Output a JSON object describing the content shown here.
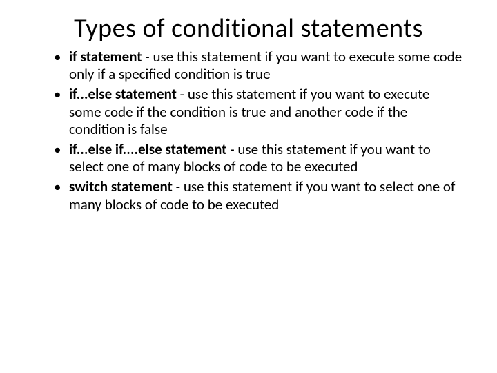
{
  "title": "Types of conditional statements",
  "items": [
    {
      "term": "if statement",
      "desc": " - use this statement if you want to execute some code only if a specified condition is true"
    },
    {
      "term": "if...else statement",
      "desc": " - use this statement if you want to execute some code if the condition is true and another code if the condition is false"
    },
    {
      "term": "if...else if....else statement",
      "desc": " - use this statement if you want to select one of many blocks of code to be executed"
    },
    {
      "term": "switch statement",
      "desc": " - use this statement if you want to select one of many blocks of code to be executed"
    }
  ]
}
